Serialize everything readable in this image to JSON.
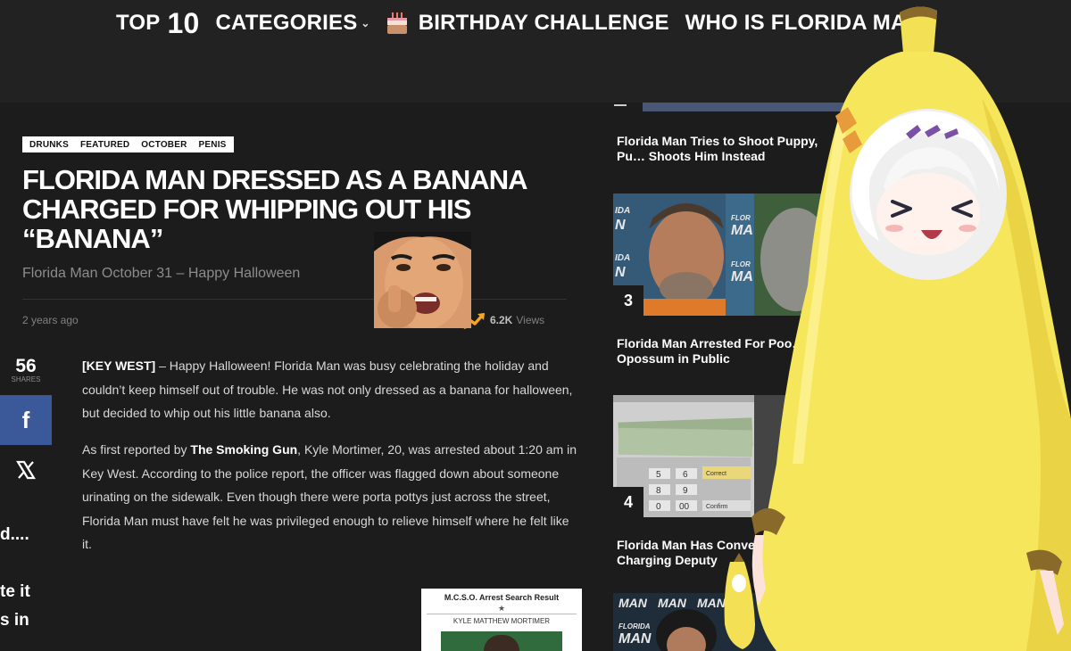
{
  "nav": {
    "top_label": "TOP",
    "top_number": "10",
    "categories": "CATEGORIES",
    "birthday": "BIRTHDAY CHALLENGE",
    "who": "WHO IS FLORIDA MAN"
  },
  "article": {
    "tags": [
      "DRUNKS",
      "FEATURED",
      "OCTOBER",
      "PENIS"
    ],
    "headline": "FLORIDA MAN DRESSED AS A BANANA CHARGED FOR WHIPPING OUT HIS “BANANA”",
    "subhead": "Florida Man October 31 – Happy Halloween",
    "date": "2 years ago",
    "views_count": "6.2K",
    "views_label": "Views",
    "p1_lead": "[KEY WEST]",
    "p1_text": " – Happy Halloween! Florida Man was busy celebrating the holiday and couldn’t keep himself out of trouble.  He was not only dressed as a banana for halloween, but decided to whip out his little banana also.",
    "p2_pre": "As first reported by ",
    "p2_link": "The Smoking Gun",
    "p2_text": ", Kyle Mortimer, 20, was arrested about 1:20 am in Key West. According to the police report, the officer was flagged down about someone urinating on the sidewalk.  Even though there were porta pottys just across the street, Florida Man must have felt he was privileged enough to relieve himself where he felt like it.",
    "arrest_title": "M.C.S.O. Arrest Search Result",
    "arrest_star": "★",
    "arrest_name": "KYLE MATTHEW MORTIMER"
  },
  "share": {
    "count": "56",
    "label": "SHARES",
    "fb": "f"
  },
  "cutoff": {
    "line1": "d....",
    "line2": "te it",
    "line3": "s in"
  },
  "sidebar": {
    "items": [
      {
        "title": "Florida Man Tries to Shoot Puppy, Pu… Shoots Him Instead"
      },
      {
        "rank": "3",
        "title": "Florida Man Arrested For Poo… Opossum in Public"
      },
      {
        "rank": "4",
        "title": "Florida Man Has Conve… Before Charging Deputy"
      }
    ],
    "thumb_text": [
      "IDA",
      "N",
      "FLOR",
      "MA",
      "MAN",
      "FLORIDA"
    ],
    "atm_keys": [
      "5",
      "6",
      "8",
      "9",
      "0",
      "00"
    ],
    "atm_labels": [
      "Correct",
      "Confirm"
    ]
  },
  "colors": {
    "accent_fb": "#3b5998",
    "banana": "#f3e55c",
    "trend": "#f5a623"
  }
}
